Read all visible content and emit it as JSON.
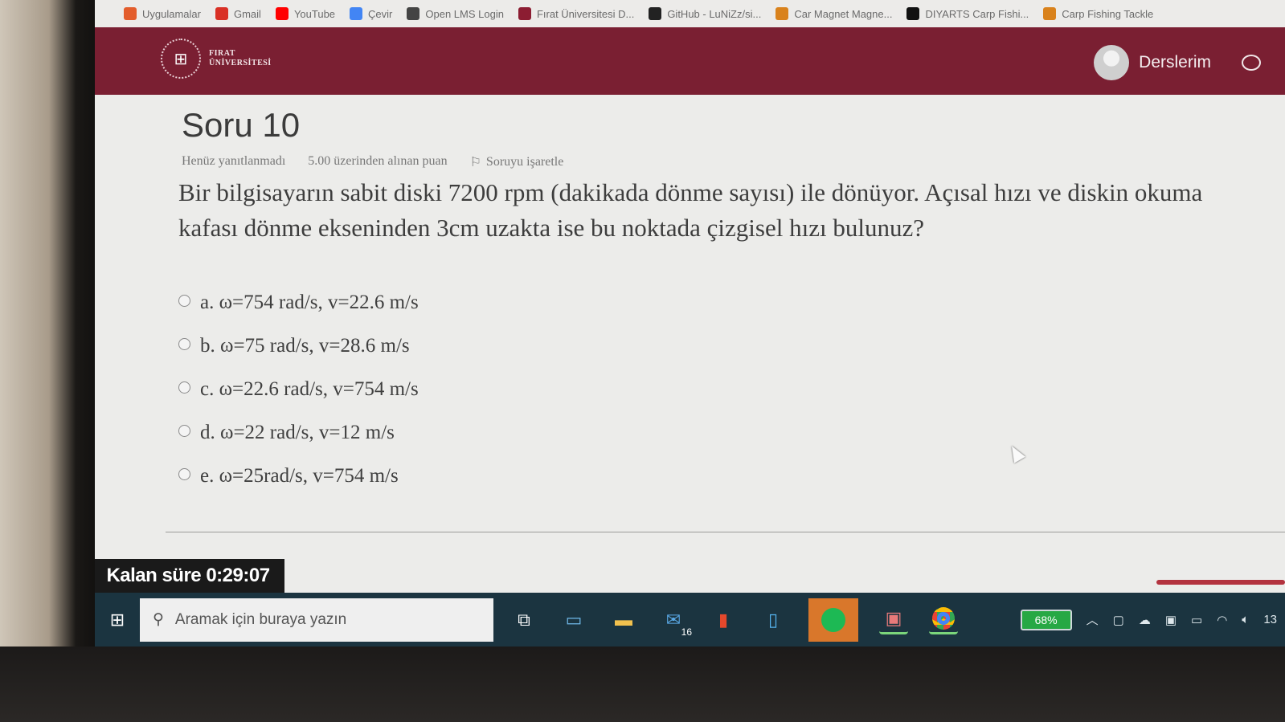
{
  "bookmarks": [
    {
      "label": "Uygulamalar",
      "icon": "apps-grid-icon",
      "color": "#e35d2c"
    },
    {
      "label": "Gmail",
      "icon": "gmail-icon",
      "color": "#d93025"
    },
    {
      "label": "YouTube",
      "icon": "youtube-icon",
      "color": "#ff0000"
    },
    {
      "label": "Çevir",
      "icon": "translate-icon",
      "color": "#4285f4"
    },
    {
      "label": "Open LMS Login",
      "icon": "globe-icon",
      "color": "#444444"
    },
    {
      "label": "Fırat Üniversitesi D...",
      "icon": "firat-bookmark-icon",
      "color": "#8c1d32"
    },
    {
      "label": "GitHub - LuNiZz/si...",
      "icon": "github-icon",
      "color": "#222222"
    },
    {
      "label": "Car Magnet Magne...",
      "icon": "shopping-bag-icon",
      "color": "#d9821c"
    },
    {
      "label": "DIYARTS Carp Fishi...",
      "icon": "amazon-icon",
      "color": "#111111"
    },
    {
      "label": "Carp Fishing Tackle",
      "icon": "shopping-bag-icon",
      "color": "#d9821c"
    }
  ],
  "header": {
    "logo_line1": "FIRAT",
    "logo_line2": "ÜNİVERSİTESİ",
    "user_menu_label": "Derslerim",
    "brand_color": "#7a1f32"
  },
  "question": {
    "title": "Soru 10",
    "status": "Henüz yanıtlanmadı",
    "marks": "5.00 üzerinden alınan puan",
    "flag_label": "Soruyu işaretle",
    "text": "Bir bilgisayarın sabit diski 7200 rpm (dakikada dönme sayısı) ile dönüyor. Açısal hızı ve diskin okuma kafası dönme ekseninden 3cm uzakta ise bu noktada çizgisel hızı bulunuz?",
    "options": [
      {
        "label": "a. ω=754 rad/s, v=22.6 m/s"
      },
      {
        "label": "b. ω=75 rad/s, v=28.6 m/s"
      },
      {
        "label": "c. ω=22.6 rad/s,  v=754 m/s"
      },
      {
        "label": "d. ω=22 rad/s, v=12 m/s"
      },
      {
        "label": "e. ω=25rad/s, v=754 m/s"
      }
    ]
  },
  "timer": {
    "label": "Kalan süre 0:29:07"
  },
  "taskbar": {
    "search_placeholder": "Aramak için buraya yazın",
    "mail_badge": "16",
    "battery_percent": "68%",
    "clock_partial": "13"
  }
}
